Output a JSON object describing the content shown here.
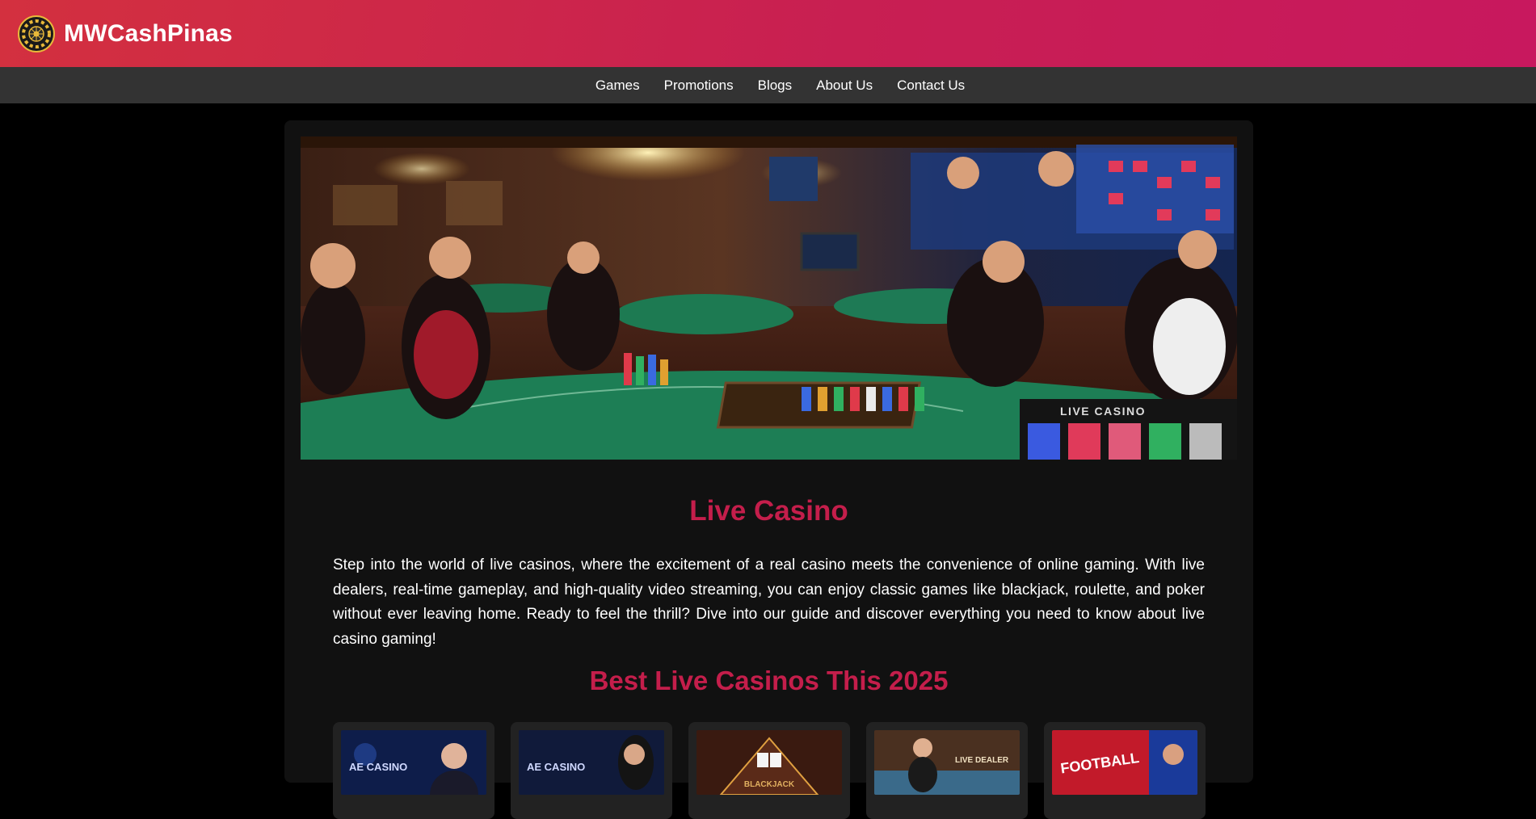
{
  "header": {
    "brand": "MWCashPinas",
    "logo_icon": "roulette-wheel-icon",
    "gradient_start": "#d3303f",
    "gradient_end": "#c8185e"
  },
  "nav": {
    "items": [
      {
        "label": "Games"
      },
      {
        "label": "Promotions"
      },
      {
        "label": "Blogs"
      },
      {
        "label": "About Us"
      },
      {
        "label": "Contact Us"
      }
    ]
  },
  "hero": {
    "overlay_text": "LIVE CASINO"
  },
  "main": {
    "title": "Live Casino",
    "intro": "Step into the world of live casinos, where the excitement of a real casino meets the convenience of online gaming. With live dealers, real-time gameplay, and high-quality video streaming, you can enjoy classic games like blackjack, roulette, and poker without ever leaving home. Ready to feel the thrill? Dive into our guide and discover everything you need to know about live casino gaming!",
    "section_title": "Best Live Casinos This 2025",
    "accent_color": "#c41e4b",
    "thumb_captions": [
      "AE CASINO",
      "AE CASINO",
      "BLACKJACK",
      "LIVE DEALER",
      "FOOTBALL"
    ]
  }
}
